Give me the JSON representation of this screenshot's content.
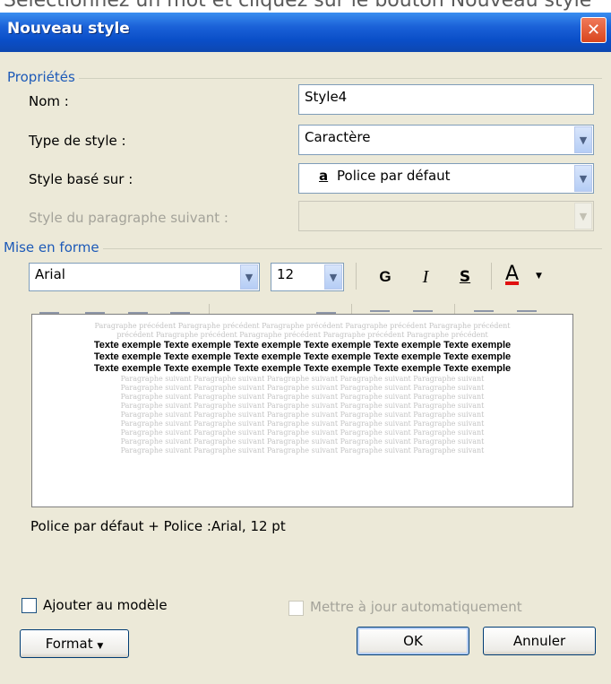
{
  "caption": "Sélectionnez un mot et cliquez sur le bouton Nouveau style",
  "window": {
    "title": "Nouveau style",
    "close_glyph": "✕"
  },
  "proprietes": {
    "group_label": "Propriétés",
    "nom_label": "Nom :",
    "nom_value": "Style4",
    "type_label": "Type de style :",
    "type_value": "Caractère",
    "base_label": "Style basé sur :",
    "base_icon": "a",
    "base_value": "Police par défaut",
    "suivant_label": "Style du paragraphe suivant :"
  },
  "mise_en_forme": {
    "group_label": "Mise en forme",
    "font_value": "Arial",
    "size_value": "12",
    "bold": "G",
    "italic": "I",
    "underline": "S",
    "font_color_letter": "A",
    "font_color": "#e01010"
  },
  "preview": {
    "previous_lines": [
      "Paragraphe précédent Paragraphe précédent Paragraphe précédent Paragraphe précédent Paragraphe précédent",
      "précédent Paragraphe précédent Paragraphe précédent Paragraphe précédent Paragraphe précédent"
    ],
    "example_lines": [
      "Texte exemple Texte exemple Texte exemple Texte exemple Texte exemple Texte exemple",
      "Texte exemple Texte exemple Texte exemple Texte exemple Texte exemple Texte exemple",
      "Texte exemple Texte exemple Texte exemple Texte exemple Texte exemple Texte exemple"
    ],
    "following_lines": [
      "Paragraphe suivant Paragraphe suivant Paragraphe suivant Paragraphe suivant Paragraphe suivant",
      "Paragraphe suivant Paragraphe suivant Paragraphe suivant Paragraphe suivant Paragraphe suivant",
      "Paragraphe suivant Paragraphe suivant Paragraphe suivant Paragraphe suivant Paragraphe suivant",
      "Paragraphe suivant Paragraphe suivant Paragraphe suivant Paragraphe suivant Paragraphe suivant",
      "Paragraphe suivant Paragraphe suivant Paragraphe suivant Paragraphe suivant Paragraphe suivant",
      "Paragraphe suivant Paragraphe suivant Paragraphe suivant Paragraphe suivant Paragraphe suivant",
      "Paragraphe suivant Paragraphe suivant Paragraphe suivant Paragraphe suivant Paragraphe suivant",
      "Paragraphe suivant Paragraphe suivant Paragraphe suivant Paragraphe suivant Paragraphe suivant",
      "Paragraphe suivant Paragraphe suivant Paragraphe suivant Paragraphe suivant Paragraphe suivant"
    ]
  },
  "description": "Police par défaut + Police :Arial, 12 pt",
  "options": {
    "ajouter_label": "Ajouter au modèle",
    "maj_label": "Mettre à jour automatiquement"
  },
  "buttons": {
    "format": "Format",
    "ok": "OK",
    "annuler": "Annuler"
  },
  "icons": {
    "close": "close-icon",
    "dropdown": "chevron-down-icon",
    "align_left": "align-left-icon",
    "align_center": "align-center-icon",
    "align_right": "align-right-icon",
    "justify": "justify-icon",
    "spacing_single": "line-spacing-single-icon",
    "spacing_1_5": "line-spacing-1-5-icon",
    "spacing_double": "line-spacing-double-icon",
    "para_space_before": "paragraph-space-before-icon",
    "para_space_after": "paragraph-space-after-icon",
    "indent_decrease": "decrease-indent-icon",
    "indent_increase": "increase-indent-icon"
  }
}
